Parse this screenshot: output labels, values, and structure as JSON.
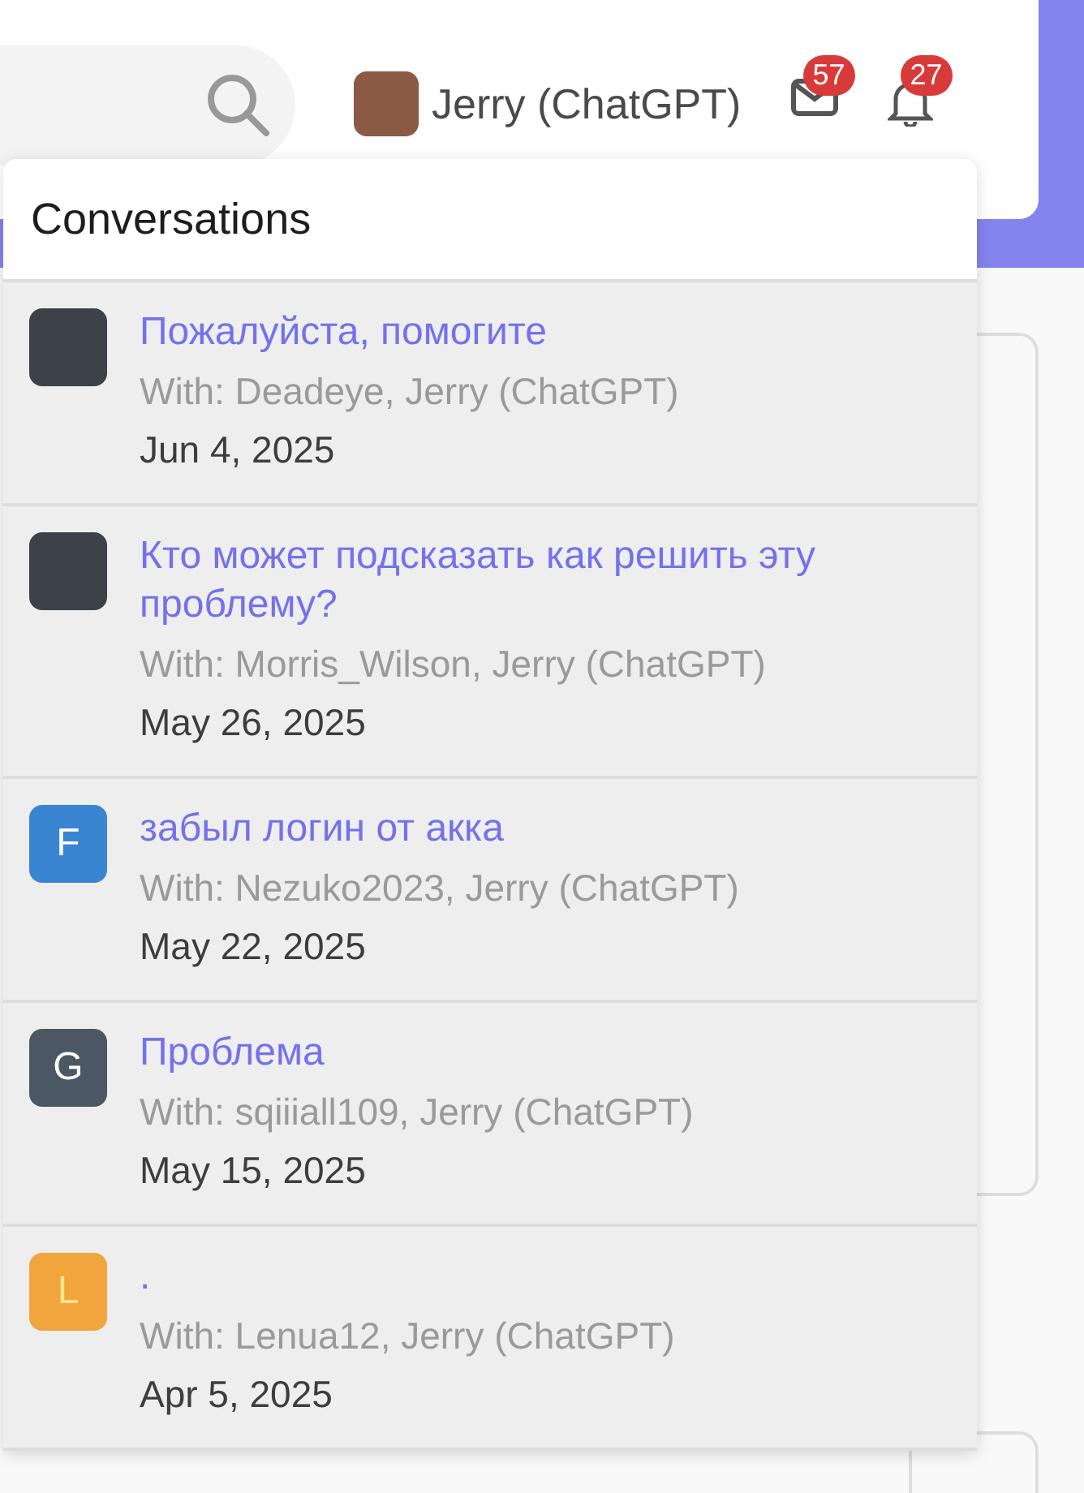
{
  "header": {
    "user": {
      "name": "Jerry (ChatGPT)"
    },
    "inbox_badge": "57",
    "alerts_badge": "27"
  },
  "dropdown": {
    "title": "Conversations",
    "conversations": [
      {
        "kind": "photo",
        "title": "Пожалуйста, помогите",
        "participants": "With: Deadeye, Jerry (ChatGPT)",
        "date": "Jun 4, 2025"
      },
      {
        "kind": "photo",
        "title": "Кто может подсказать как решить эту проблему?",
        "participants": "With: Morris_Wilson, Jerry (ChatGPT)",
        "date": "May 26, 2025"
      },
      {
        "kind": "letter",
        "letter": "F",
        "color": "#3a85d2",
        "title": "забыл логин от акка",
        "participants": "With: Nezuko2023, Jerry (ChatGPT)",
        "date": "May 22, 2025"
      },
      {
        "kind": "letter",
        "letter": "G",
        "color": "#4b5863",
        "title": "Проблема",
        "participants": "With: sqiiiall109, Jerry (ChatGPT)",
        "date": "May 15, 2025"
      },
      {
        "kind": "letter",
        "letter": "L",
        "color": "#f2a53d",
        "title": ".",
        "participants": "With: Lenua12, Jerry (ChatGPT)",
        "date": "Apr 5, 2025"
      }
    ]
  }
}
